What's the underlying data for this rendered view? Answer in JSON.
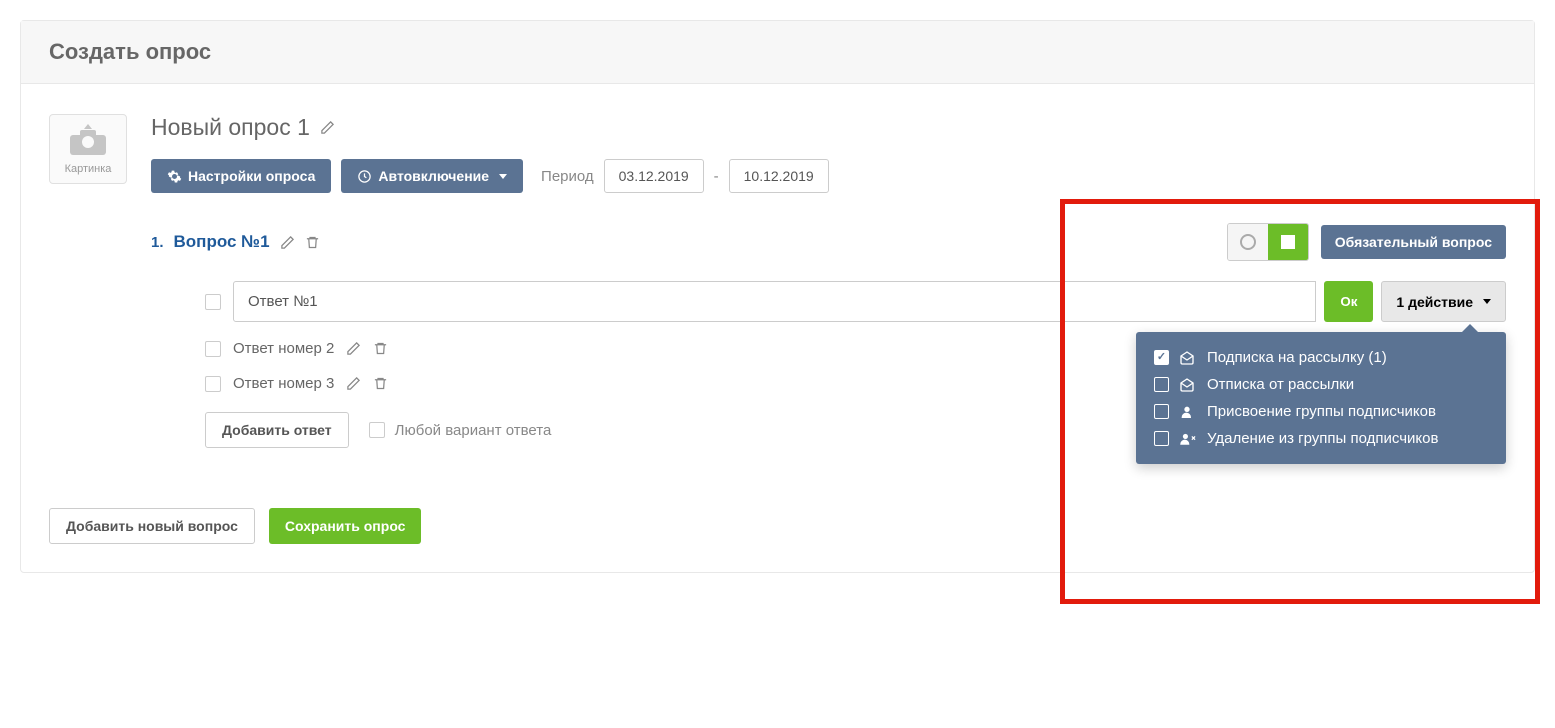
{
  "page_title": "Создать опрос",
  "survey_name": "Новый опрос 1",
  "image_label": "Картинка",
  "settings_btn": "Настройки опроса",
  "auto_on_btn": "Автовключение",
  "period_label": "Период",
  "date_from": "03.12.2019",
  "date_to": "10.12.2019",
  "question": {
    "number": "1.",
    "text": "Вопрос №1",
    "required_label": "Обязательный вопрос"
  },
  "answers": [
    {
      "text": "Ответ №1",
      "editing": true
    },
    {
      "text": "Ответ номер 2",
      "editing": false
    },
    {
      "text": "Ответ номер 3",
      "editing": false
    }
  ],
  "ok_label": "Ок",
  "action_count_label": "1 действие",
  "dropdown": [
    {
      "checked": true,
      "icon": "mail-open",
      "label": "Подписка на рассылку (1)"
    },
    {
      "checked": false,
      "icon": "mail-out",
      "label": "Отписка от рассылки"
    },
    {
      "checked": false,
      "icon": "user",
      "label": "Присвоение группы подписчиков"
    },
    {
      "checked": false,
      "icon": "user-x",
      "label": "Удаление из группы подписчиков"
    }
  ],
  "add_answer_btn": "Добавить ответ",
  "any_answer_label": "Любой вариант ответа",
  "add_question_btn": "Добавить новый вопрос",
  "save_btn": "Сохранить опрос"
}
